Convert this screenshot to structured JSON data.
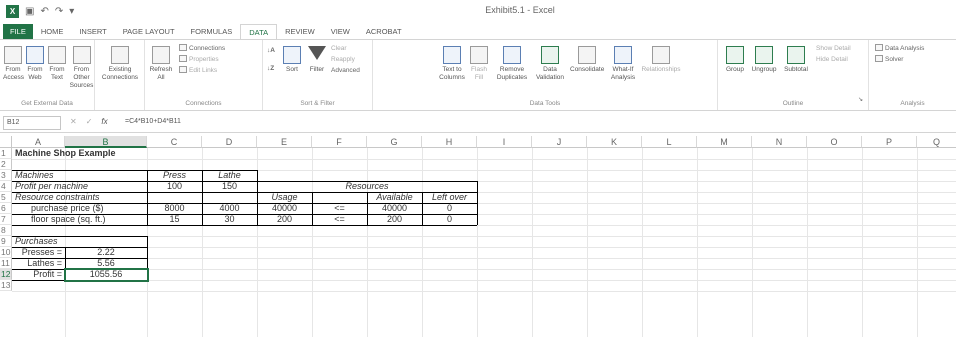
{
  "window": {
    "title": "Exhibit5.1 - Excel"
  },
  "tabs": [
    "FILE",
    "HOME",
    "INSERT",
    "PAGE LAYOUT",
    "FORMULAS",
    "DATA",
    "REVIEW",
    "VIEW",
    "ACROBAT"
  ],
  "active_tab": "DATA",
  "ribbon": {
    "get_external": {
      "label": "Get External Data",
      "buttons": [
        "From Access",
        "From Web",
        "From Text",
        "From Other Sources"
      ]
    },
    "existing_connections": "Existing Connections",
    "connections": {
      "label": "Connections",
      "refresh": "Refresh All",
      "small": [
        "Connections",
        "Properties",
        "Edit Links"
      ]
    },
    "sort_filter": {
      "label": "Sort & Filter",
      "sort": "Sort",
      "filter": "Filter",
      "small": [
        "Clear",
        "Reapply",
        "Advanced"
      ]
    },
    "data_tools": {
      "label": "Data Tools",
      "buttons": [
        "Text to Columns",
        "Flash Fill",
        "Remove Duplicates",
        "Data Validation",
        "Consolidate",
        "What-If Analysis",
        "Relationships"
      ]
    },
    "outline": {
      "label": "Outline",
      "buttons": [
        "Group",
        "Ungroup",
        "Subtotal"
      ],
      "small": [
        "Show Detail",
        "Hide Detail"
      ]
    },
    "analysis": {
      "label": "Analysis",
      "small": [
        "Data Analysis",
        "Solver"
      ]
    }
  },
  "formula_bar": {
    "name_box": "B12",
    "formula": "=C4*B10+D4*B11",
    "fx": "fx"
  },
  "columns": [
    "A",
    "B",
    "C",
    "D",
    "E",
    "F",
    "G",
    "H",
    "I",
    "J",
    "K",
    "L",
    "M",
    "N",
    "O",
    "P",
    "Q"
  ],
  "rows": [
    "1",
    "2",
    "3",
    "4",
    "5",
    "6",
    "7",
    "8",
    "9",
    "10",
    "11",
    "12",
    "13"
  ],
  "selected_cell": "B12",
  "cells": {
    "title": "Machine Shop Example",
    "machines": "Machines",
    "press": "Press",
    "lathe": "Lathe",
    "profit_per_machine": "Profit per machine",
    "profit_press": "100",
    "profit_lathe": "150",
    "resources": "Resources",
    "resource_constraints": "Resource constraints",
    "usage": "Usage",
    "available": "Available",
    "left_over": "Left over",
    "purchase_price": "purchase price ($)",
    "pp_press": "8000",
    "pp_lathe": "4000",
    "pp_usage": "40000",
    "pp_op": "<=",
    "pp_available": "40000",
    "pp_left": "0",
    "floor_space": "floor space (sq. ft.)",
    "fs_press": "15",
    "fs_lathe": "30",
    "fs_usage": "200",
    "fs_op": "<=",
    "fs_available": "200",
    "fs_left": "0",
    "purchases": "Purchases",
    "presses_label": "Presses =",
    "presses_value": "2.22",
    "lathes_label": "Lathes =",
    "lathes_value": "5.56",
    "profit_label": "Profit =",
    "profit_value": "1055.56"
  }
}
